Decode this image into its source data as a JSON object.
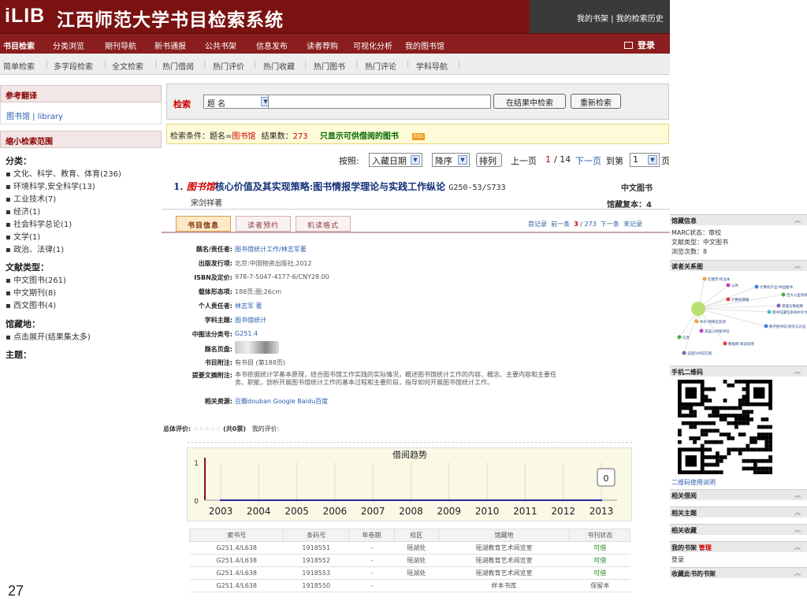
{
  "header": {
    "logo": "iLIB",
    "title": "江西师范大学书目检索系统",
    "right_links": "我的书架 | 我的检索历史"
  },
  "nav": {
    "items": [
      "书目检索",
      "分类浏览",
      "期刊导航",
      "新书通报",
      "公共书架",
      "信息发布",
      "读者荐购",
      "可视化分析",
      "我的图书馆"
    ],
    "login": "登录"
  },
  "subnav": {
    "items": [
      "简单检索",
      "多字段检索",
      "全文检索",
      "热门借阅",
      "热门评价",
      "热门收藏",
      "热门图书",
      "热门评论",
      "学科导航"
    ]
  },
  "sidebar": {
    "ref_title": "参考翻译",
    "ref_text": "图书馆 | library",
    "narrow_title": "缩小检索范围",
    "class_label": "分类：",
    "class_items": [
      "文化、科学、教育、体育(236)",
      "环境科学,安全科学(13)",
      "工业技术(7)",
      "经济(1)",
      "社会科学总论(1)",
      "文学(1)",
      "政治、法律(1)"
    ],
    "doctype_label": "文献类型：",
    "doctype_items": [
      "中文图书(261)",
      "中文期刊(8)",
      "西文图书(4)"
    ],
    "loc_label": "馆藏地：",
    "loc_items": [
      "点击展开(结果集太多)"
    ],
    "subject_label": "主题："
  },
  "search": {
    "label": "检索",
    "field": "题 名",
    "query": "",
    "btn_within": "在结果中检索",
    "btn_new": "重新检索"
  },
  "condition": {
    "prefix": "检索条件：题名=",
    "term": "图书馆",
    "count_label": "结果数：",
    "count": "273",
    "available": "只显示可供借阅的图书",
    "rss": "RSS"
  },
  "sort": {
    "label": "按照:",
    "field": "入藏日期",
    "order": "降序",
    "btn": "排列",
    "prev": "上一页",
    "page": "1",
    "total": "/ 14",
    "next": "下一页",
    "goto": "到第",
    "goto_page": "1",
    "page_suffix": "页"
  },
  "result": {
    "index": "1.",
    "title_hl": "图书馆",
    "title_rest": "核心价值及其实现策略:图书情报学理论与实践工作纵论",
    "call": "G250-53/S733",
    "type": "中文图书",
    "author": "宋剑祥著",
    "holding": "馆藏复本：4"
  },
  "detail": {
    "tabs": [
      "书目信息",
      "读者预约",
      "机读格式"
    ],
    "record_nav": {
      "first": "首记录",
      "prev": "前一条",
      "current": "3",
      "total": "/ 273",
      "next": "下一条",
      "last": "末记录"
    },
    "fields": [
      {
        "label": "题名/责任者:",
        "value": "图书馆统计工作/林志军著"
      },
      {
        "label": "出版发行项:",
        "value": "北京:中国物资出版社,2012"
      },
      {
        "label": "ISBN及定价:",
        "value": "978-7-5047-4177-6/CNY28.00"
      },
      {
        "label": "载体形态项:",
        "value": "188页;图;26cm"
      },
      {
        "label": "个人责任者:",
        "value": "林志军 著"
      },
      {
        "label": "学科主题:",
        "value": "图书馆统计"
      },
      {
        "label": "中图法分类号:",
        "value": "G251.4"
      },
      {
        "label": "题名页盘:",
        "value": ""
      },
      {
        "label": "书目附注:",
        "value": "有书目 (第188页)"
      },
      {
        "label": "提要文摘附注:",
        "value": "本书依据统计学基本原理，结合图书馆工作实践的实际情况，概述图书馆统计工作的内容、概念、主要内容和主要任务、职能，剖析开展图书馆统计工作的基本过程和主要阶段，指导如何开展图书馆统计工作。"
      },
      {
        "label": "相关资源:",
        "value": "豆瓣douban  Google  Baidu百度"
      }
    ],
    "rating_label": "总体评价:",
    "rating_stars": "☆☆☆☆☆",
    "rating_count": "(共0票)",
    "my_rating": "我的评价:"
  },
  "chart_data": {
    "type": "line",
    "title": "借阅趋势",
    "x": [
      2003,
      2004,
      2005,
      2006,
      2007,
      2008,
      2009,
      2010,
      2011,
      2012,
      2013
    ],
    "series": [
      {
        "values": [
          0,
          0,
          0,
          0,
          0,
          0,
          0,
          0,
          0,
          0,
          0
        ]
      }
    ],
    "ylim": [
      0,
      1
    ],
    "yticks": [
      0,
      1
    ],
    "badge": "0",
    "grid": true,
    "colors": {
      "line": "#2a2a9a",
      "axis": "#8a1212"
    }
  },
  "holdings": {
    "headers": [
      "索书号",
      "条码号",
      "年卷期",
      "校区",
      "馆藏地",
      "书刊状态"
    ],
    "rows": [
      [
        "G251.4/L638",
        "1918551",
        "-",
        "瑶湖处",
        "瑶湖教育艺术阅览室",
        "可借"
      ],
      [
        "G251.4/L638",
        "1918552",
        "-",
        "瑶湖处",
        "瑶湖教育艺术阅览室",
        "可借"
      ],
      [
        "G251.4/L638",
        "1918553",
        "-",
        "瑶湖处",
        "瑶湖教育艺术阅览室",
        "可借"
      ],
      [
        "G251.4/L638",
        "1918550",
        "-",
        "",
        "样本书库",
        "保留本"
      ]
    ]
  },
  "right": {
    "sec1_title": "馆藏信息",
    "sec1_lines": [
      "MARC状态：审校",
      "文献类型：中文图书",
      "浏览次数：8"
    ],
    "sec2_title": "读者关系图",
    "graph_labels": [
      "红楼梦·校注本",
      "公共",
      "计算机产品·中国图书",
      "百大公里系统",
      "计算机网络",
      "管理与数据库",
      "图书馆藏馆系统中外文·情报小说",
      "中外·网络馆资源",
      "美国公共图书馆",
      "数字图书馆·研究与论证",
      "信息",
      "数据库·阅读指南",
      "美国500馆实践"
    ],
    "sec3_title": "手机二维码",
    "qr_link": "二维码使用说明",
    "sections": [
      "相关借阅",
      "相关主题",
      "相关收藏",
      "我的书架",
      "收藏此书的书架"
    ],
    "my_shelf_sub": "管理",
    "login_link": "登录"
  },
  "page_number": "27"
}
